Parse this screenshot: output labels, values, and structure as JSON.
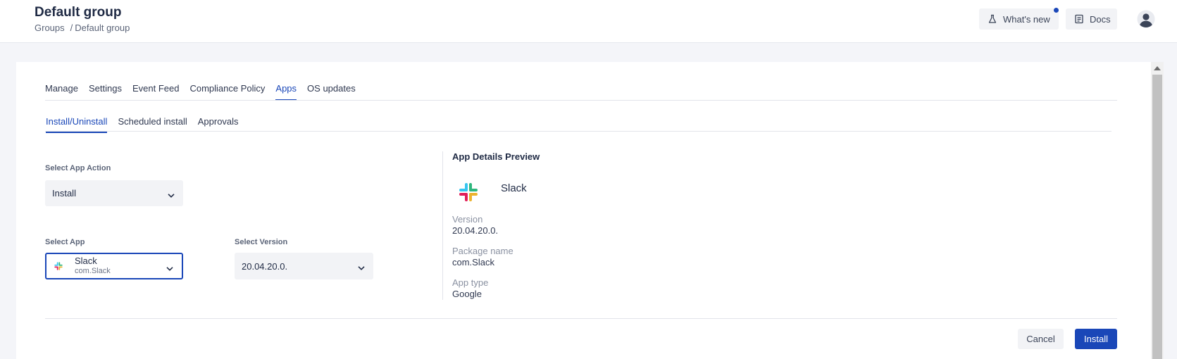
{
  "header": {
    "title": "Default group",
    "breadcrumb": {
      "root": "Groups",
      "separator": "/",
      "current": "Default group"
    },
    "whats_new_label": "What's new",
    "docs_label": "Docs"
  },
  "tabs": [
    {
      "label": "Manage"
    },
    {
      "label": "Settings"
    },
    {
      "label": "Event Feed"
    },
    {
      "label": "Compliance Policy"
    },
    {
      "label": "Apps",
      "active": true
    },
    {
      "label": "OS updates"
    }
  ],
  "subtabs": [
    {
      "label": "Install/Uninstall",
      "active": true
    },
    {
      "label": "Scheduled install"
    },
    {
      "label": "Approvals"
    }
  ],
  "form": {
    "action_label": "Select App Action",
    "action_value": "Install",
    "app_label": "Select App",
    "app_name": "Slack",
    "app_package": "com.Slack",
    "version_label": "Select Version",
    "version_value": "20.04.20.0."
  },
  "preview": {
    "title": "App Details Preview",
    "app_name": "Slack",
    "version_label": "Version",
    "version_value": "20.04.20.0.",
    "package_label": "Package name",
    "package_value": "com.Slack",
    "type_label": "App type",
    "type_value": "Google"
  },
  "actions": {
    "cancel_label": "Cancel",
    "install_label": "Install"
  },
  "icons": {
    "flask": "flask-icon",
    "docs": "docs-icon",
    "avatar": "user-avatar-icon",
    "chevron": "chevron-down-icon",
    "slack": "slack-logo-icon"
  },
  "colors": {
    "accent": "#1a47b8",
    "header_bg": "#ffffff",
    "page_bg": "#f4f5f9",
    "button_bg": "#f2f3f6",
    "slack_blue": "#36c5f0",
    "slack_green": "#2eb67d",
    "slack_red": "#e01e5a",
    "slack_yellow": "#ecb22e"
  }
}
